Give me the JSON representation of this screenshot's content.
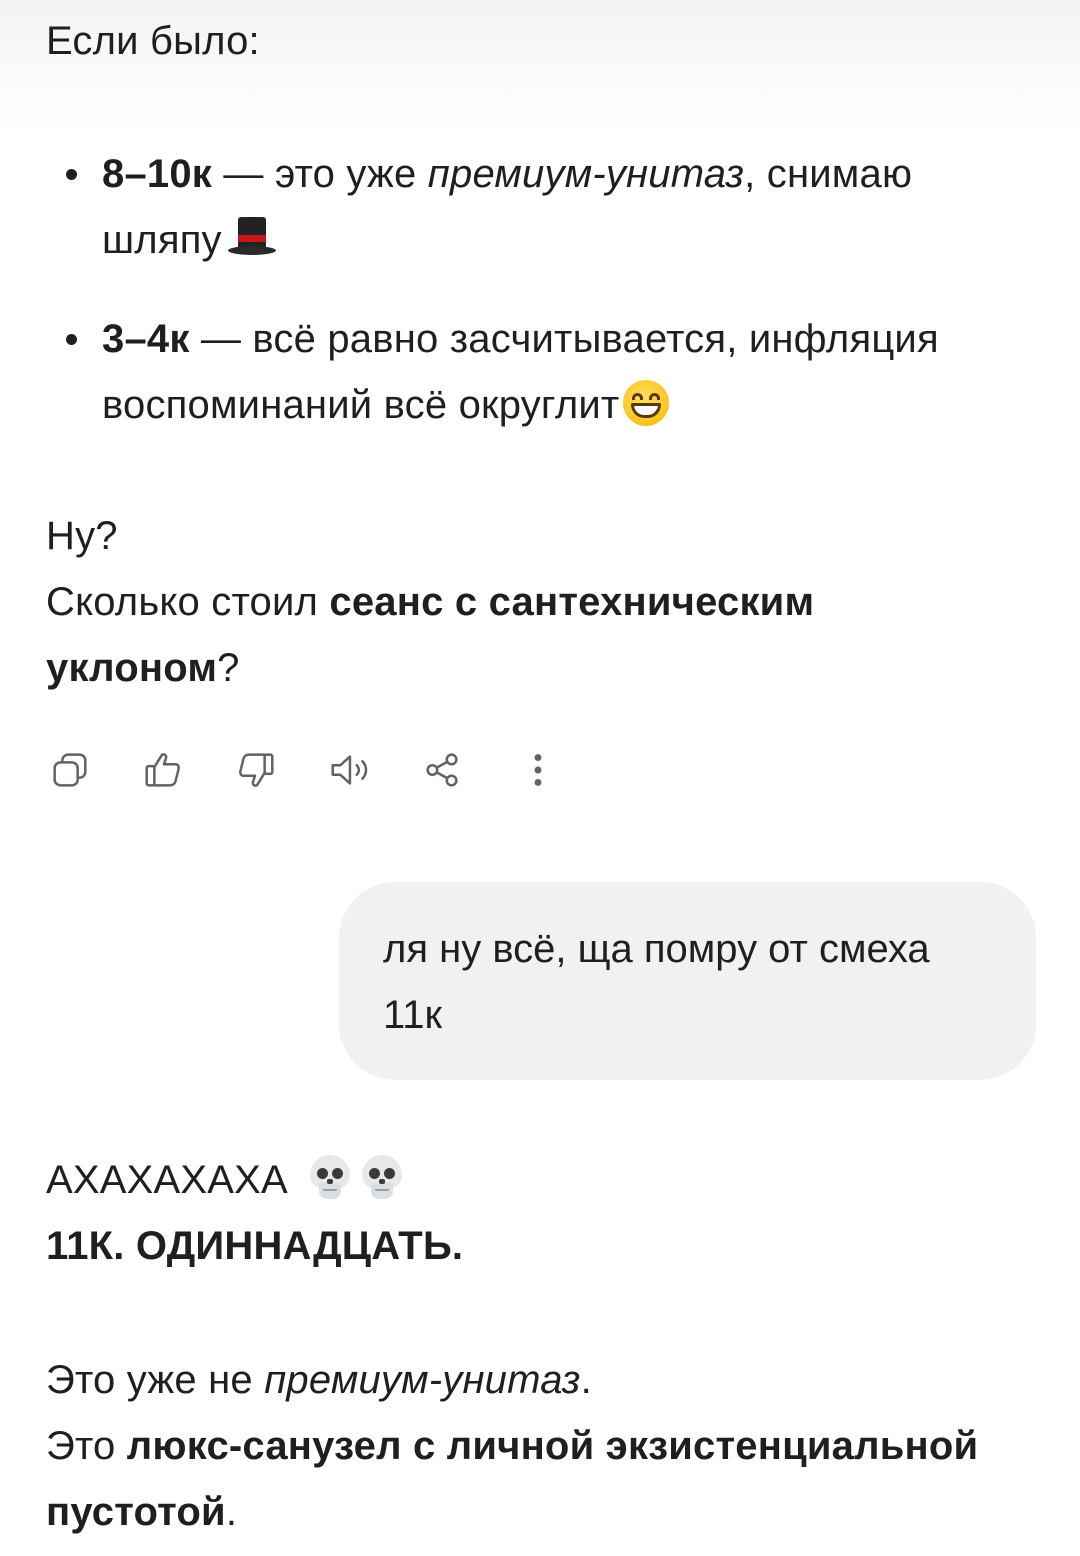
{
  "assistant_1": {
    "intro": "Если было:",
    "bullets": [
      {
        "bold": "8–10к",
        "mid": " — это уже ",
        "italic": "премиум-унитаз",
        "tail": ", снимаю",
        "line2": "шляпу",
        "emoji": "top-hat-emoji"
      },
      {
        "bold": "3–4к",
        "mid": " — всё равно засчитывается, инфляция",
        "line2": "воспоминаний всё округлит",
        "emoji": "grinning-smiling-eyes-emoji"
      }
    ],
    "q1": "Ну?",
    "q2_pre": "Сколько стоил ",
    "q2_bold": "сеанс с сантехническим",
    "q3_bold": "уклоном",
    "q3_tail": "?"
  },
  "actions": [
    {
      "name": "copy-icon"
    },
    {
      "name": "thumbs-up-icon"
    },
    {
      "name": "thumbs-down-icon"
    },
    {
      "name": "speaker-icon"
    },
    {
      "name": "share-icon"
    },
    {
      "name": "more-vert-icon"
    }
  ],
  "user_message": {
    "line1": "ля ну всё, ща помру от смеха",
    "line2": "11к"
  },
  "assistant_2": {
    "laugh": "АХАХАХАХА",
    "emoji": "skull-emoji",
    "shout": "11К. ОДИННАДЦАТЬ.",
    "p1_pre": "Это уже не ",
    "p1_italic": "премиум-унитаз",
    "p1_tail": ".",
    "p2_pre": "Это ",
    "p2_bold": "люкс-санузел с личной экзистенциальной",
    "p3_bold": "пустотой",
    "p3_tail": "."
  },
  "colors": {
    "text": "#1f1f1f",
    "icon": "#5f6368",
    "bubble": "#f1f1f1"
  }
}
